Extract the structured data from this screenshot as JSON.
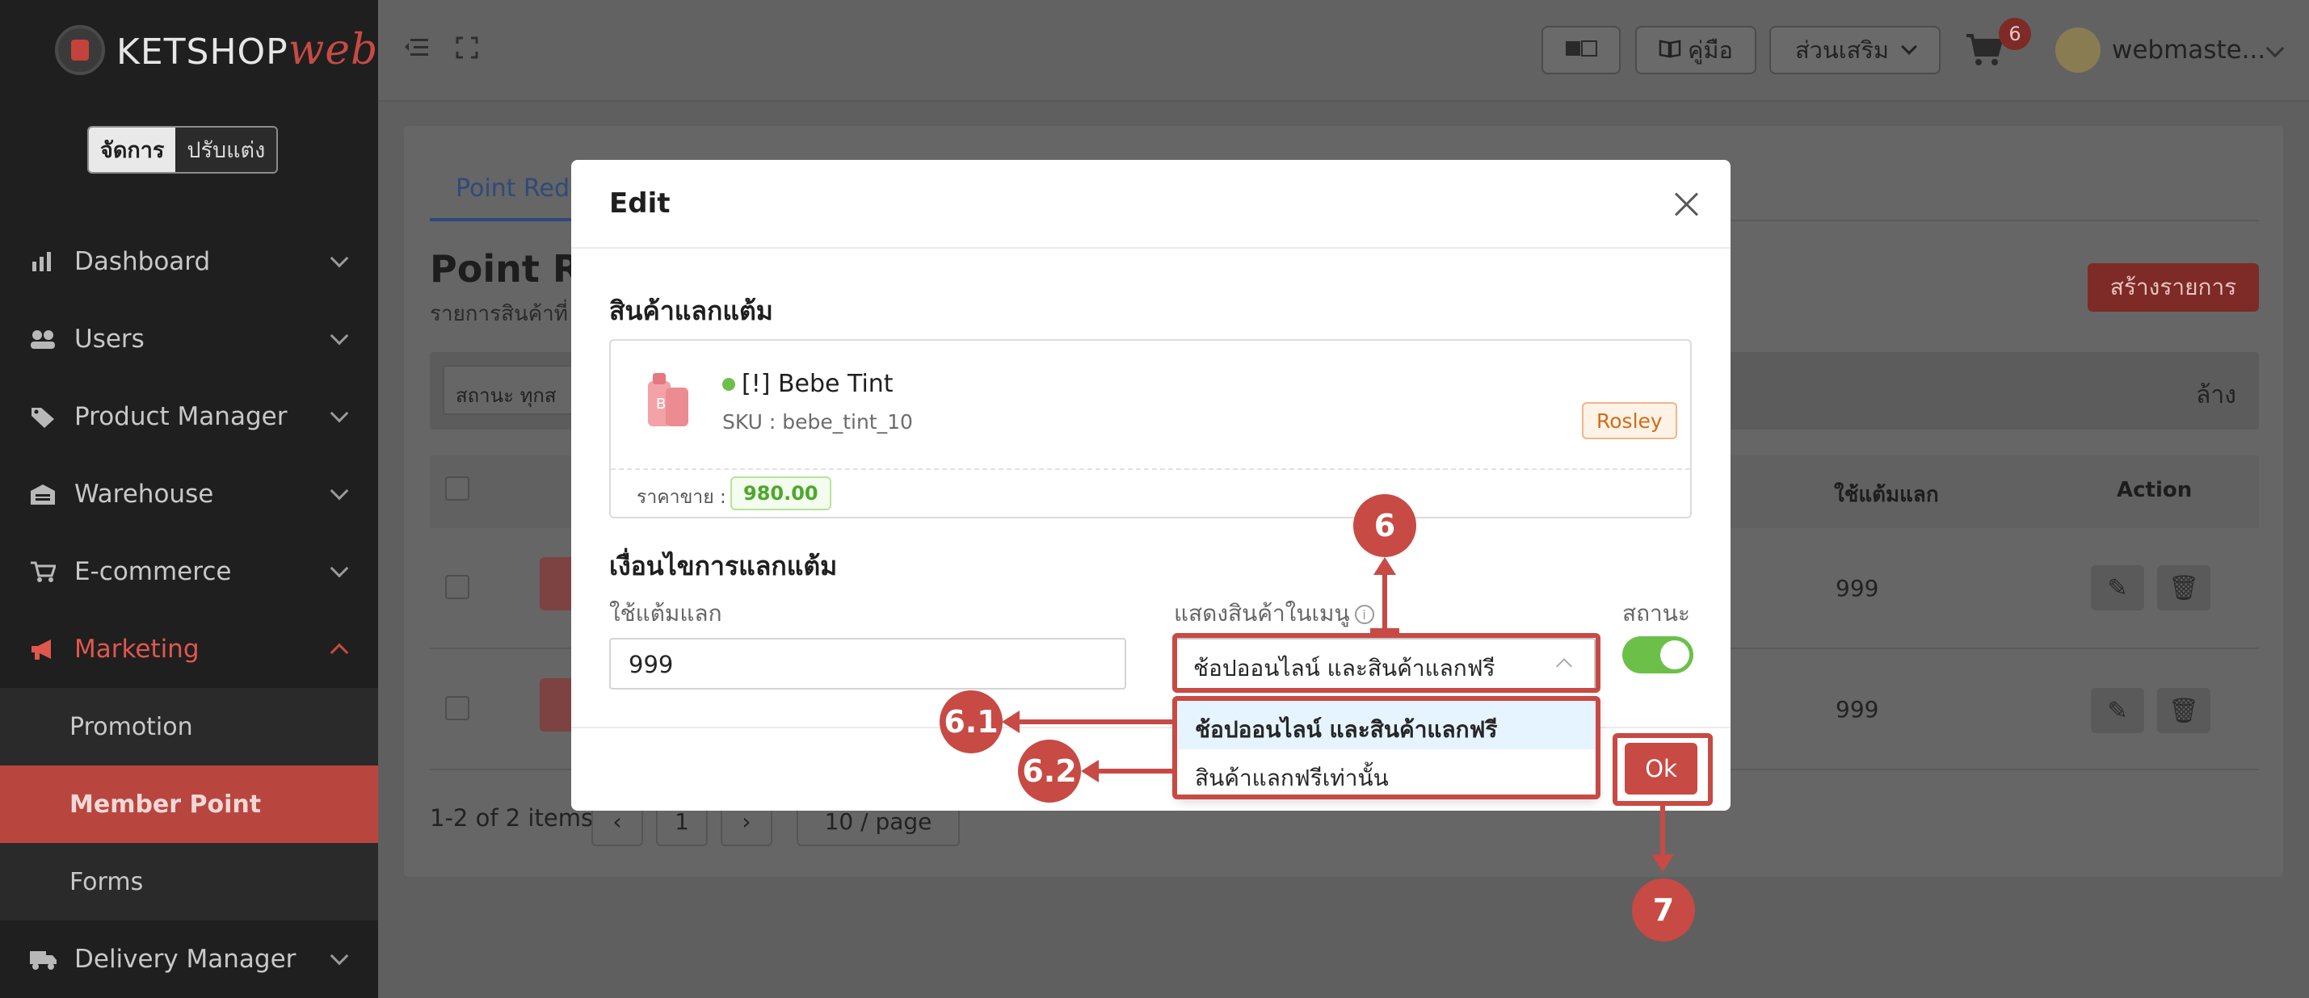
{
  "app": {
    "logo_text": "KETSHOP",
    "logo_accent": "web",
    "mode_manage": "จัดการ",
    "mode_customize": "ปรับแต่ง"
  },
  "sidebar": {
    "items": [
      {
        "label": "Dashboard",
        "icon": "chart-icon"
      },
      {
        "label": "Users",
        "icon": "users-icon"
      },
      {
        "label": "Product Manager",
        "icon": "tags-icon"
      },
      {
        "label": "Warehouse",
        "icon": "warehouse-icon"
      },
      {
        "label": "E-commerce",
        "icon": "cart-icon"
      },
      {
        "label": "Marketing",
        "icon": "megaphone-icon",
        "expanded": true
      },
      {
        "label": "Delivery Manager",
        "icon": "truck-icon"
      }
    ],
    "marketing_sub": [
      "Promotion",
      "Member Point",
      "Forms"
    ],
    "selected_sub": "Member Point"
  },
  "topbar": {
    "manual_label": "คู่มือ",
    "addons_label": "ส่วนเสริม",
    "cart_count": "6",
    "user_name": "webmaste..."
  },
  "background": {
    "tab_label": "Point Rede",
    "page_title": "Point Re",
    "page_subtitle": "รายการสินค้าที่",
    "create_button": "สร้างรายการ",
    "status_filter": "สถานะ   ทุกส",
    "clear_label": "ล้าง",
    "col_points": "ใช้แต้มแลก",
    "col_action": "Action",
    "rows": [
      {
        "points": "999"
      },
      {
        "points": "999"
      }
    ],
    "pagination_info": "1-2 of 2 items",
    "page_number": "1",
    "page_size": "10 / page"
  },
  "modal": {
    "title": "Edit",
    "product_section": "สินค้าแลกแต้ม",
    "product_name": "[!] Bebe Tint",
    "product_sku": "SKU : bebe_tint_10",
    "brand": "Rosley",
    "price_label": "ราคาขาย :",
    "price": "980.00",
    "conditions_section": "เงื่อนไขการแลกแต้ม",
    "points_label": "ใช้แต้มแลก",
    "points_value": "999",
    "menu_label": "แสดงสินค้าในเมนู",
    "menu_selected": "ช้อปออนไลน์ และสินค้าแลกฟรี",
    "status_label": "สถานะ",
    "status_on": true,
    "ok_label": "Ok"
  },
  "dropdown": {
    "options": [
      "ช้อปออนไลน์ และสินค้าแลกฟรี",
      "สินค้าแลกฟรีเท่านั้น"
    ]
  },
  "annotations": {
    "step_6": "6",
    "step_6_1": "6.1",
    "step_6_2": "6.2",
    "step_7": "7"
  },
  "colors": {
    "accent": "#c74a44",
    "toggle_on": "#6cc04a",
    "price_green": "#4ca82a",
    "brand_orange": "#d46b14"
  }
}
